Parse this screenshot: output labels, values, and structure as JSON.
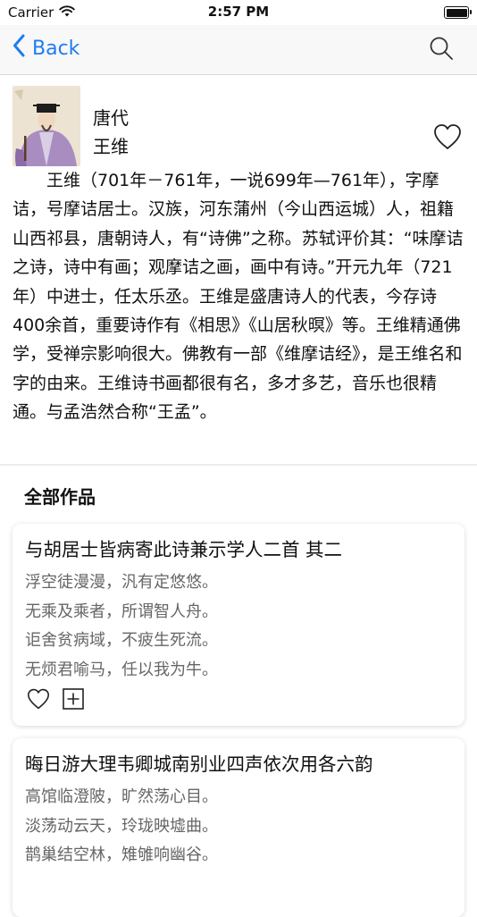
{
  "status_bar": {
    "carrier": "Carrier",
    "time": "2:57 PM"
  },
  "nav": {
    "back_label": "Back",
    "back_icon": "chevron-left-icon",
    "search_icon": "search-icon",
    "accent_color": "#1e7cf2"
  },
  "author": {
    "dynasty": "唐代",
    "name": "王维",
    "bio": "王维（701年－761年，一说699年—761年），字摩诘，号摩诘居士。汉族，河东蒲州（今山西运城）人，祖籍山西祁县，唐朝诗人，有“诗佛”之称。苏轼评价其：“味摩诘之诗，诗中有画；观摩诘之画，画中有诗。”开元九年（721年）中进士，任太乐丞。王维是盛唐诗人的代表，今存诗400余首，重要诗作有《相思》《山居秋暝》等。王维精通佛学，受禅宗影响很大。佛教有一部《维摩诘经》，是王维名和字的由来。王维诗书画都很有名，多才多艺，音乐也很精通。与孟浩然合称“王孟”。"
  },
  "works": {
    "section_title": "全部作品",
    "items": [
      {
        "title": "与胡居士皆病寄此诗兼示学人二首 其二",
        "lines": [
          "浮空徒漫漫，汎有定悠悠。",
          "无乘及乘者，所谓智人舟。",
          "讵舍贫病域，不疲生死流。",
          "无烦君喻马，任以我为牛。"
        ]
      },
      {
        "title": "晦日游大理韦卿城南别业四声依次用各六韵",
        "lines": [
          "高馆临澄陂，旷然荡心目。",
          "淡荡动云天，玲珑映墟曲。",
          "鹊巢结空林，雉雊响幽谷。"
        ]
      }
    ]
  }
}
